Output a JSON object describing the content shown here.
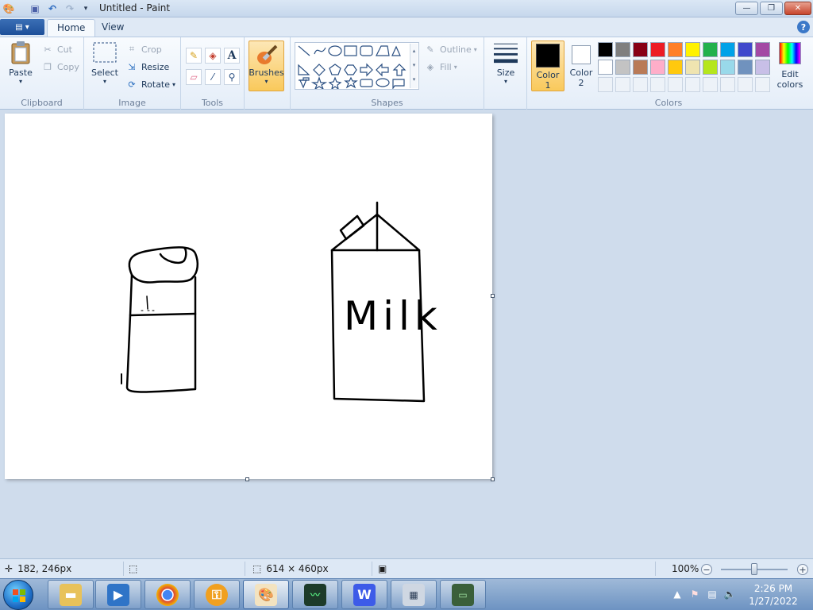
{
  "window": {
    "title": "Untitled - Paint",
    "minimize": "—",
    "maximize": "❐",
    "close": "✕"
  },
  "tabs": {
    "file": "▤ ▾",
    "home": "Home",
    "view": "View",
    "help": "?"
  },
  "ribbon": {
    "clipboard": {
      "label": "Clipboard",
      "paste": "Paste",
      "cut": "Cut",
      "copy": "Copy"
    },
    "image": {
      "label": "Image",
      "select": "Select",
      "crop": "Crop",
      "resize": "Resize",
      "rotate": "Rotate"
    },
    "tools": {
      "label": "Tools",
      "text_icon": "A"
    },
    "brushes": {
      "label": "Brushes"
    },
    "shapes": {
      "label": "Shapes",
      "outline": "Outline",
      "fill": "Fill"
    },
    "size": {
      "label": "Size"
    },
    "color1": {
      "line1": "Color",
      "line2": "1",
      "value": "#000000"
    },
    "color2": {
      "line1": "Color",
      "line2": "2",
      "value": "#ffffff"
    },
    "colors": {
      "label": "Colors",
      "edit_line1": "Edit",
      "edit_line2": "colors",
      "row1": [
        "#000000",
        "#7f7f7f",
        "#880015",
        "#ed1c24",
        "#ff7f27",
        "#fff200",
        "#22b14c",
        "#00a2e8",
        "#3f48cc",
        "#a349a4"
      ],
      "row2": [
        "#ffffff",
        "#c3c3c3",
        "#b97a57",
        "#ffaec9",
        "#ffc90e",
        "#efe4b0",
        "#b5e61d",
        "#99d9ea",
        "#7092be",
        "#c8bfe7"
      ]
    }
  },
  "canvas": {
    "drawing_text": "Milk",
    "stroke_color": "#000000"
  },
  "status": {
    "cursor_pos": "182, 246px",
    "canvas_size": "614 × 460px",
    "zoom": "100%",
    "zoom_out": "−",
    "zoom_in": "+"
  },
  "taskbar": {
    "time": "2:26 PM",
    "date": "1/27/2022",
    "tray_up": "▲",
    "apps": [
      "explorer",
      "media-player",
      "chrome",
      "vpn",
      "paint",
      "monitor",
      "wps",
      "calculator",
      "remote-desktop"
    ]
  }
}
